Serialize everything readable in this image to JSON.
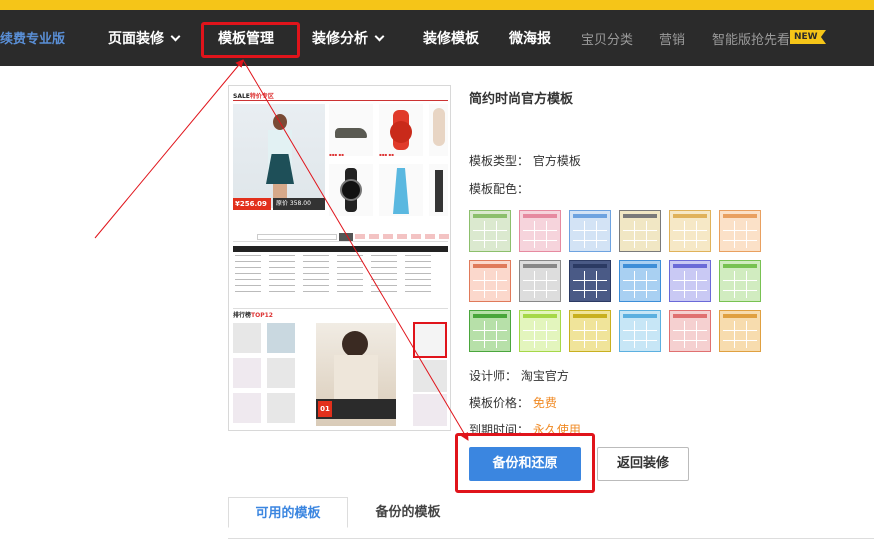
{
  "colors": {
    "accent": "#3b86e0",
    "highlight": "#e0141b",
    "nav_bg": "#2b2b2b",
    "top_strip": "#f5c518",
    "orange": "#f08a24"
  },
  "nav": {
    "brand": "续费专业版",
    "items": [
      {
        "label": "页面装修",
        "has_dropdown": true
      },
      {
        "label": "模板管理",
        "has_dropdown": false,
        "highlighted": true
      },
      {
        "label": "装修分析",
        "has_dropdown": true
      },
      {
        "label": "装修模板",
        "has_dropdown": false
      },
      {
        "label": "微海报",
        "has_dropdown": false
      },
      {
        "label": "宝贝分类",
        "has_dropdown": false,
        "dimmed": true
      },
      {
        "label": "营销",
        "has_dropdown": false,
        "dimmed": true
      },
      {
        "label": "智能版抢先看",
        "has_dropdown": false,
        "dimmed": true
      }
    ],
    "new_badge": "NEW"
  },
  "preview": {
    "logo_prefix": "SALE",
    "logo_suffix": "特价专区",
    "price_main": "¥256.09",
    "price_orig": "原价 358.00",
    "top_label": "排行榜",
    "top_suffix": "TOP12",
    "big_num": "01"
  },
  "template": {
    "name": "简约时尚官方模板",
    "type_label": "模板类型：",
    "type_value": "官方模板",
    "color_label": "模板配色：",
    "designer_label": "设计师：",
    "designer_value": "淘宝官方",
    "price_label": "模板价格：",
    "price_value": "免费",
    "expire_label": "到期时间：",
    "expire_value": "永久使用"
  },
  "swatches": [
    {
      "bar": "#8cbf6c",
      "fill": "#dbe9cf"
    },
    {
      "bar": "#e68aa0",
      "fill": "#f6d4dc"
    },
    {
      "bar": "#6ea3e0",
      "fill": "#d3e3f5"
    },
    {
      "bar": "#7a7a7a",
      "fill": "#f1e7c4"
    },
    {
      "bar": "#e0b25a",
      "fill": "#f6e8c6"
    },
    {
      "bar": "#e9a060",
      "fill": "#fbe1c8"
    },
    {
      "bar": "#e07a5a",
      "fill": "#fbd8cc"
    },
    {
      "bar": "#888888",
      "fill": "#dddddd"
    },
    {
      "bar": "#2b3a63",
      "fill": "#4a5a86"
    },
    {
      "bar": "#3d8ed8",
      "fill": "#a9d0f2"
    },
    {
      "bar": "#6a6ad8",
      "fill": "#c9c9f4"
    },
    {
      "bar": "#78c252",
      "fill": "#d1ecc0"
    },
    {
      "bar": "#4aa63c",
      "fill": "#b7e0a9"
    },
    {
      "bar": "#a6d848",
      "fill": "#e3f5bd"
    },
    {
      "bar": "#c8b020",
      "fill": "#f0e49a"
    },
    {
      "bar": "#5cb0e0",
      "fill": "#c7e6f6"
    },
    {
      "bar": "#e07070",
      "fill": "#f5d0d0"
    },
    {
      "bar": "#e0a040",
      "fill": "#f7dcae"
    }
  ],
  "buttons": {
    "backup": "备份和还原",
    "back": "返回装修"
  },
  "tabs": [
    {
      "label": "可用的模板",
      "active": true
    },
    {
      "label": "备份的模板",
      "active": false
    }
  ]
}
